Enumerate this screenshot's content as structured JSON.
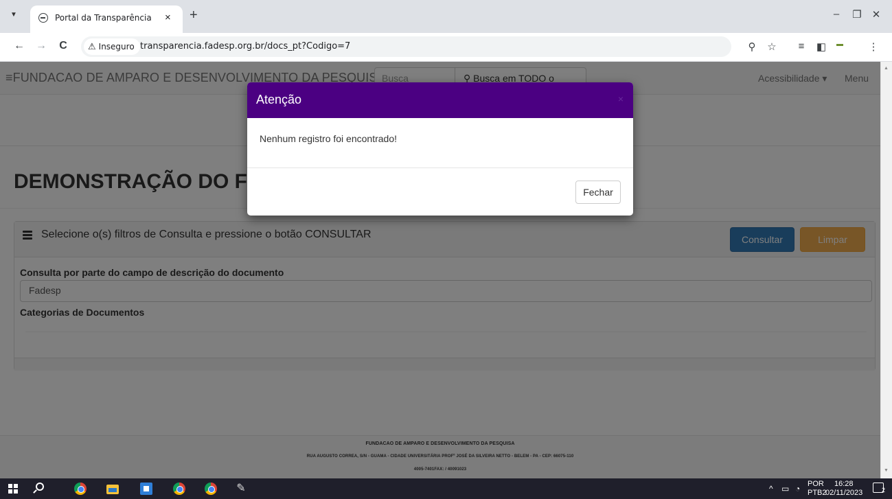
{
  "browser": {
    "tab_title": "Portal da Transparência",
    "tab_close": "×",
    "new_tab": "+",
    "insecure_label": "Inseguro",
    "url": "transparencia.fadesp.org.br/docs_pt?Codigo=7",
    "window_controls": {
      "minimize": "–",
      "restore": "❐",
      "close": "✕"
    },
    "icons": {
      "back": "←",
      "forward": "→",
      "reload": "C",
      "search": "⚲",
      "bookmark": "☆",
      "more": "⋮",
      "warning": "⚠"
    }
  },
  "site_nav": {
    "brand": "FUNDACAO DE AMPARO E DESENVOLVIMENTO DA PESQUISA",
    "menu_glyph": "≡",
    "search_placeholder": "Busca",
    "search_button": "Busca em TODO o Portal",
    "accessibility": "Acessibilidade ▾",
    "menu": "Menu"
  },
  "page": {
    "title": "DEMONSTRAÇÃO DO FLUXO DE CAIXA",
    "panel_heading": "Selecione o(s) filtros de Consulta e pressione o botão CONSULTAR",
    "consultar_label": "Consultar",
    "limpar_label": "Limpar",
    "desc_field_label": "Consulta por parte do campo de descrição do documento",
    "desc_field_value": "Fadesp",
    "categories_label": "Categorias de Documentos"
  },
  "footer": {
    "line1": "FUNDACAO DE AMPARO E DESENVOLVIMENTO DA PESQUISA",
    "line2": "RUA AUGUSTO CORREA, S/N - GUAMA - CIDADE UNIVERSITÁRIA PROFº JOSÉ DA SILVEIRA NETTO - BELEM - PA - CEP: 66075-110",
    "line3": "4005-7401FAX: / 40091023"
  },
  "modal": {
    "title": "Atenção",
    "close": "×",
    "message": "Nenhum registro foi encontrado!",
    "close_button": "Fechar",
    "header_color": "#4b0082"
  },
  "taskbar": {
    "language": "POR",
    "layout": "PTB2",
    "time": "16:28",
    "date": "02/11/2023",
    "notification_count": "2"
  }
}
